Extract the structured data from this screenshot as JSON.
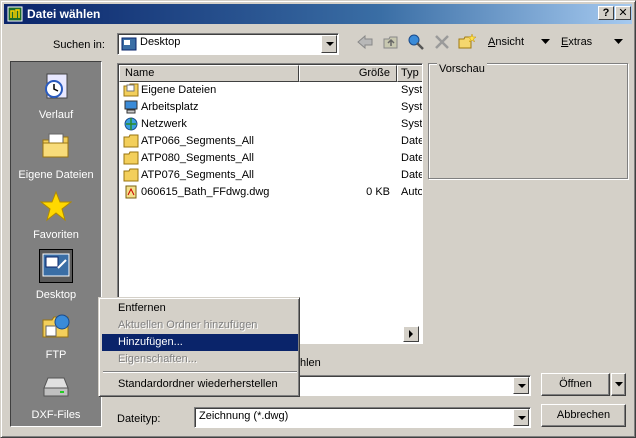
{
  "window": {
    "title": "Datei wählen",
    "help_label": "?",
    "close_label": "✕"
  },
  "toolbar": {
    "look_in_label": "Suchen in:",
    "look_in_value": "Desktop",
    "view_label": "Ansicht",
    "tools_label": "Extras"
  },
  "places": [
    {
      "label": "Verlauf",
      "icon": "history-icon"
    },
    {
      "label": "Eigene Dateien",
      "icon": "my-documents-icon"
    },
    {
      "label": "Favoriten",
      "icon": "favorites-star-icon"
    },
    {
      "label": "Desktop",
      "icon": "desktop-icon"
    },
    {
      "label": "FTP",
      "icon": "ftp-icon"
    },
    {
      "label": "DXF-Files",
      "icon": "drive-icon"
    }
  ],
  "list": {
    "columns": [
      "Name",
      "Größe",
      "Typ"
    ],
    "rows": [
      {
        "name": "Eigene Dateien",
        "size": "",
        "type": "Syst",
        "icon": "my-documents-icon"
      },
      {
        "name": "Arbeitsplatz",
        "size": "",
        "type": "Syst",
        "icon": "computer-icon"
      },
      {
        "name": "Netzwerk",
        "size": "",
        "type": "Syst",
        "icon": "network-icon"
      },
      {
        "name": "ATP066_Segments_All",
        "size": "",
        "type": "Date",
        "icon": "folder-icon"
      },
      {
        "name": "ATP080_Segments_All",
        "size": "",
        "type": "Date",
        "icon": "folder-icon"
      },
      {
        "name": "ATP076_Segments_All",
        "size": "",
        "type": "Date",
        "icon": "folder-icon"
      },
      {
        "name": "060615_Bath_FFdwg.dwg",
        "size": "0 KB",
        "type": "Auto",
        "icon": "dwg-file-icon"
      }
    ]
  },
  "preview": {
    "label": "Vorschau"
  },
  "filename": {
    "partial_label": "hlen",
    "value": ""
  },
  "filetype": {
    "label": "Dateityp:",
    "value": "Zeichnung (*.dwg)"
  },
  "buttons": {
    "open_label": "Öffnen",
    "cancel_label": "Abbrechen"
  },
  "context_menu": [
    {
      "label": "Entfernen",
      "enabled": true,
      "highlighted": false
    },
    {
      "label": "Aktuellen Ordner hinzufügen",
      "enabled": false,
      "highlighted": false
    },
    {
      "label": "Hinzufügen...",
      "enabled": true,
      "highlighted": true
    },
    {
      "label": "Eigenschaften...",
      "enabled": false,
      "highlighted": false
    },
    {
      "label": "Standardordner wiederherstellen",
      "enabled": true,
      "highlighted": false
    }
  ],
  "colors": {
    "title_active": "#0a246a",
    "face": "#d4d0c8",
    "places_bg": "#808080",
    "highlight": "#0a246a"
  }
}
